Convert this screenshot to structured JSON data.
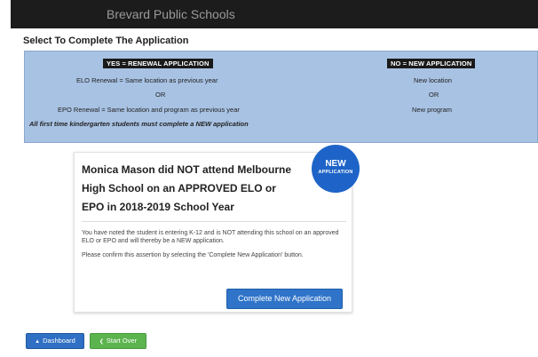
{
  "header": {
    "title": "Brevard Public Schools"
  },
  "section_title": "Select To Complete The Application",
  "options_panel": {
    "renewal": {
      "tag": "YES = RENEWAL APPLICATION",
      "line1": "ELO Renewal = Same location as previous year",
      "or": "OR",
      "line2": "EPO Renewal = Same location and program as previous year"
    },
    "new": {
      "tag": "NO = NEW APPLICATION",
      "line1": "New location",
      "or": "OR",
      "line2": "New program"
    },
    "note": "All first time kindergarten students must complete a NEW application"
  },
  "card": {
    "heading": "Monica Mason did NOT attend Melbourne High School on an APPROVED ELO or EPO in 2018-2019 School Year",
    "text1": "You have noted the student is entering K-12 and is NOT attending this school on an approved ELO or EPO and will thereby be a NEW application.",
    "text2": "Please confirm this assertion by selecting the 'Complete New Application' button.",
    "button_label": "Complete New Application"
  },
  "badge": {
    "main": "NEW",
    "sub": "APPLICATION"
  },
  "footer": {
    "dashboard_label": "Dashboard",
    "startover_label": "Start Over"
  },
  "colors": {
    "panel_bg": "#a8c2e3",
    "primary": "#2f74c9",
    "badge": "#1e64c8",
    "success": "#5cb44f",
    "header_bg": "#1c1c1c"
  },
  "icons": {
    "dashboard": "chevron-up-icon",
    "startover": "chevron-left-icon"
  }
}
